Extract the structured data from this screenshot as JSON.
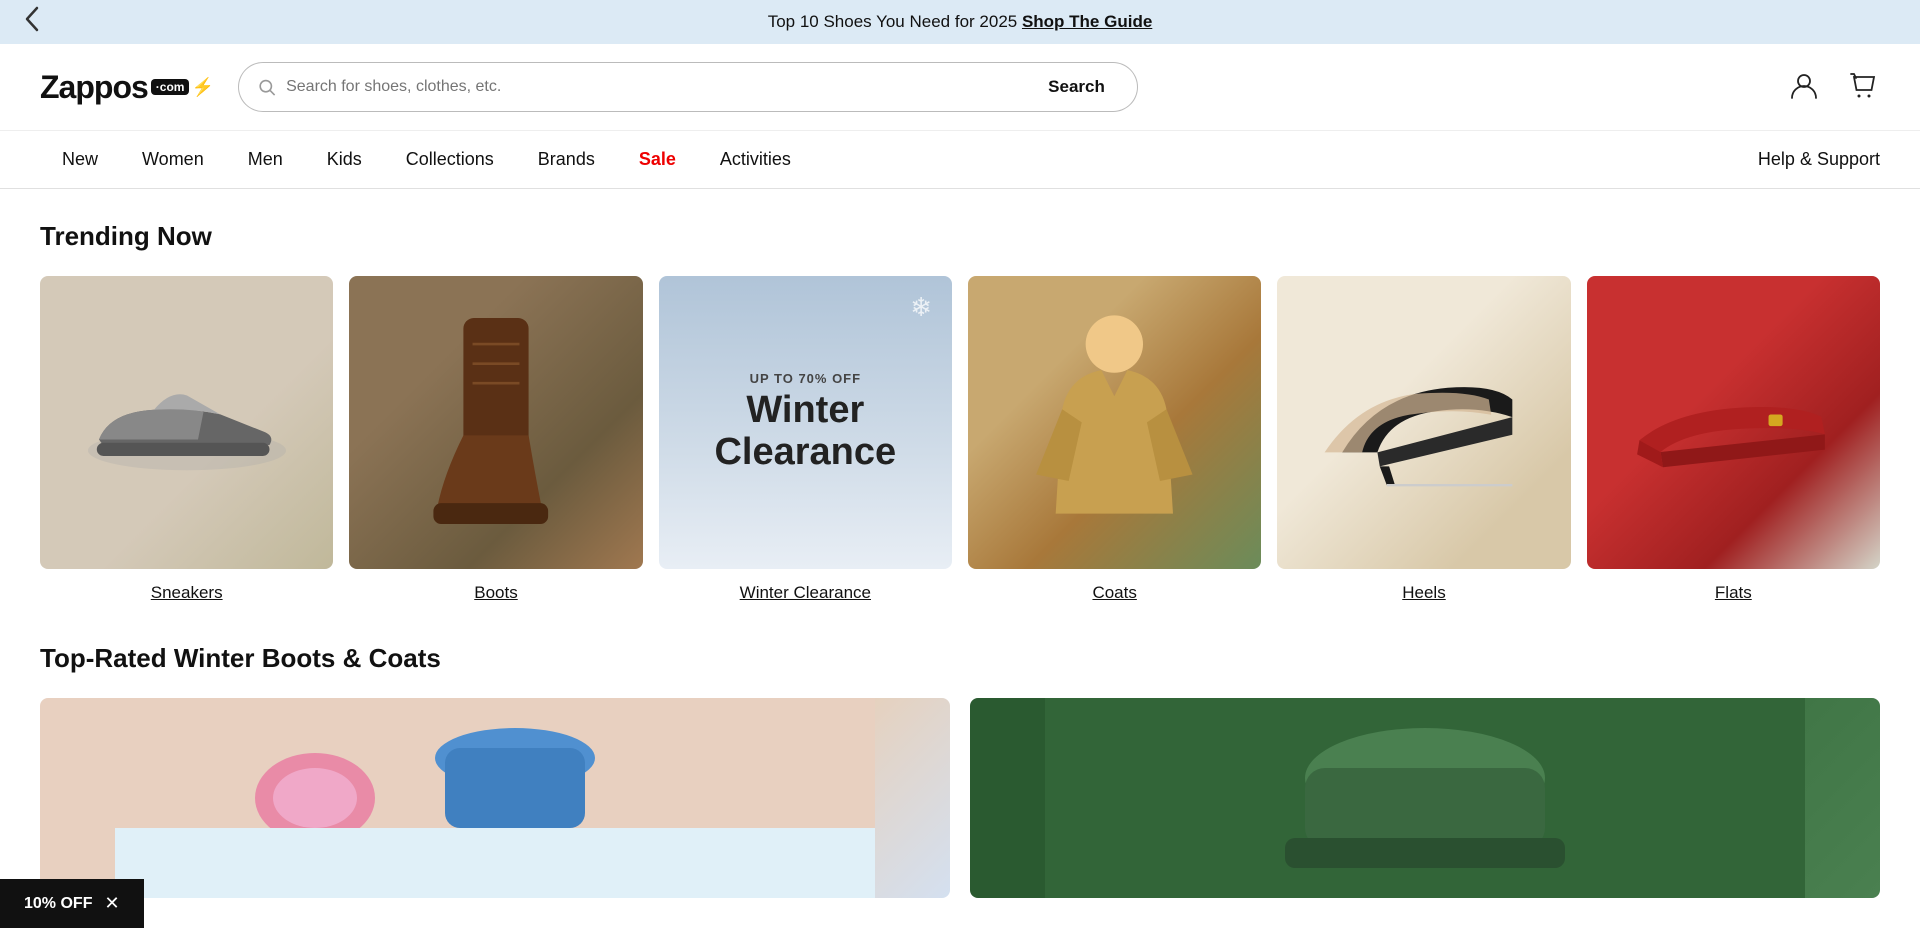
{
  "banner": {
    "text": "Top 10 Shoes You Need for 2025 ",
    "link_text": "Shop The Guide",
    "back_button_label": "‹"
  },
  "header": {
    "logo": "Zappos",
    "logo_sub": "·com",
    "search_placeholder": "Search for shoes, clothes, etc.",
    "search_button_label": "Search",
    "account_icon": "👤",
    "cart_icon": "🛍"
  },
  "nav": {
    "items": [
      {
        "label": "New",
        "id": "new",
        "sale": false
      },
      {
        "label": "Women",
        "id": "women",
        "sale": false
      },
      {
        "label": "Men",
        "id": "men",
        "sale": false
      },
      {
        "label": "Kids",
        "id": "kids",
        "sale": false
      },
      {
        "label": "Collections",
        "id": "collections",
        "sale": false
      },
      {
        "label": "Brands",
        "id": "brands",
        "sale": false
      },
      {
        "label": "Sale",
        "id": "sale",
        "sale": true
      },
      {
        "label": "Activities",
        "id": "activities",
        "sale": false
      }
    ],
    "help_label": "Help & Support"
  },
  "trending": {
    "section_title": "Trending Now",
    "items": [
      {
        "id": "sneakers",
        "label": "Sneakers",
        "color_class": "img-sneakers"
      },
      {
        "id": "boots",
        "label": "Boots",
        "color_class": "img-boots"
      },
      {
        "id": "winter-clearance",
        "label": "Winter Clearance",
        "color_class": "img-clearance",
        "promo_small": "UP TO 70% OFF",
        "promo_large": "Winter\nClearance"
      },
      {
        "id": "coats",
        "label": "Coats",
        "color_class": "img-coats"
      },
      {
        "id": "heels",
        "label": "Heels",
        "color_class": "img-heels"
      },
      {
        "id": "flats",
        "label": "Flats",
        "color_class": "img-flats"
      }
    ]
  },
  "top_rated": {
    "section_title": "Top-Rated Winter Boots & Coats"
  },
  "promo_bar": {
    "label": "10% OFF",
    "close_label": "✕"
  }
}
